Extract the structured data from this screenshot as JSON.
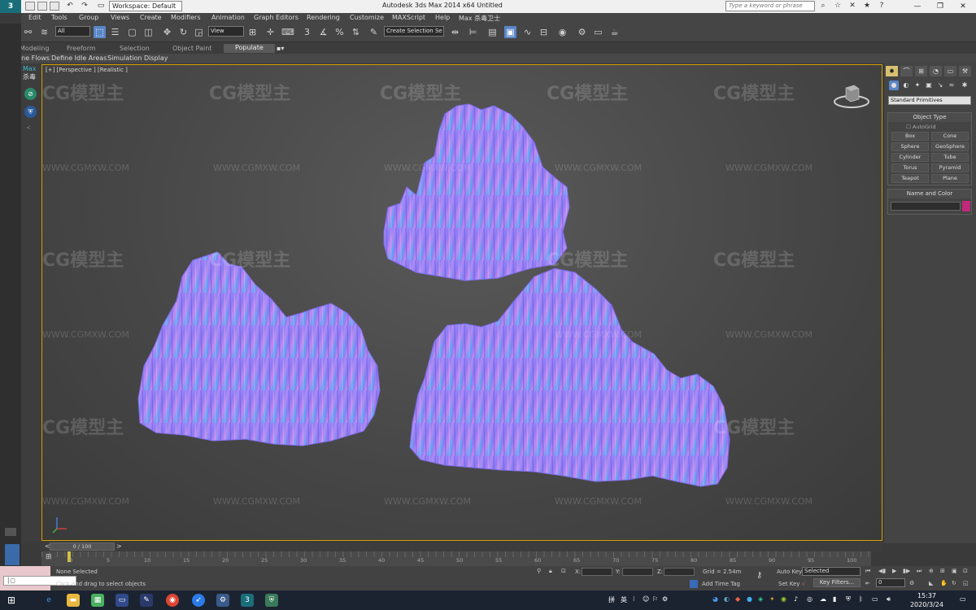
{
  "title_bar": {
    "logo": "3",
    "workspace": "Workspace: Default",
    "title": "Autodesk 3ds Max  2014 x64      Untitled",
    "search_placeholder": "Type a keyword or phrase"
  },
  "menu": [
    "Edit",
    "Tools",
    "Group",
    "Views",
    "Create",
    "Modifiers",
    "Animation",
    "Graph Editors",
    "Rendering",
    "Customize",
    "MAXScript",
    "Help",
    "Max 杀毒卫士"
  ],
  "toolbar": {
    "filter": "All",
    "view_combo": "View",
    "named_selection": "Create Selection Se"
  },
  "ribbon": {
    "tabs": [
      "Modeling",
      "Freeform",
      "Selection",
      "Object Paint",
      "Populate"
    ],
    "active_tab": "Populate",
    "items": [
      "Define Flows",
      "Define Idle Areas",
      "Simulation",
      "Display"
    ]
  },
  "left_strip": {
    "label": "Max",
    "sub": "杀毒"
  },
  "viewport": {
    "label": "[+] [Perspective ] [Realistic ]",
    "accent_color": "#d4a000",
    "watermark": "CG模型主",
    "watermark_url": "WWW.CGMXW.COM"
  },
  "command_panel": {
    "category": "Standard Primitives",
    "object_type_title": "Object Type",
    "autogrid": "AutoGrid",
    "buttons": [
      "Box",
      "Cone",
      "Sphere",
      "GeoSphere",
      "Cylinder",
      "Tube",
      "Torus",
      "Pyramid",
      "Teapot",
      "Plane"
    ],
    "name_color_title": "Name and Color",
    "swatch_color": "#c0287a"
  },
  "timeline": {
    "frame": "0 / 100",
    "ticks": [
      "0",
      "5",
      "10",
      "15",
      "20",
      "25",
      "30",
      "35",
      "40",
      "45",
      "50",
      "55",
      "60",
      "65",
      "70",
      "75",
      "80",
      "85",
      "90",
      "95",
      "100"
    ]
  },
  "status": {
    "selection": "None Selected",
    "prompt": "Click and drag to select objects",
    "x_label": "X:",
    "y_label": "Y:",
    "z_label": "Z:",
    "grid": "Grid = 2.54m",
    "add_time_tag": "Add Time Tag",
    "auto_key": "Auto Key",
    "set_key": "Set Key",
    "selected": "Selected",
    "key_filters": "Key Filters...",
    "frame_field": "0"
  },
  "taskbar": {
    "ime": "英",
    "time": "15:37",
    "date": "2020/3/24"
  }
}
